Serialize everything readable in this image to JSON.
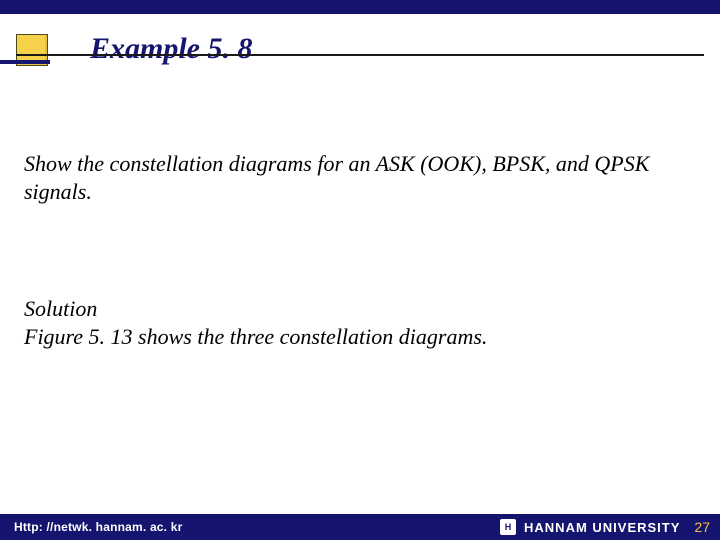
{
  "header": {
    "title": "Example 5. 8"
  },
  "body": {
    "problem": "Show the constellation diagrams for an ASK (OOK), BPSK, and QPSK signals.",
    "solution_label": "Solution",
    "solution_text": "Figure 5. 13 shows the three constellation diagrams."
  },
  "footer": {
    "url": "Http: //netwk. hannam. ac. kr",
    "university": "HANNAM  UNIVERSITY",
    "page": "27"
  },
  "colors": {
    "brand_navy": "#15156f",
    "accent_yellow": "#f6d24a",
    "page_number": "#f2c03e"
  }
}
